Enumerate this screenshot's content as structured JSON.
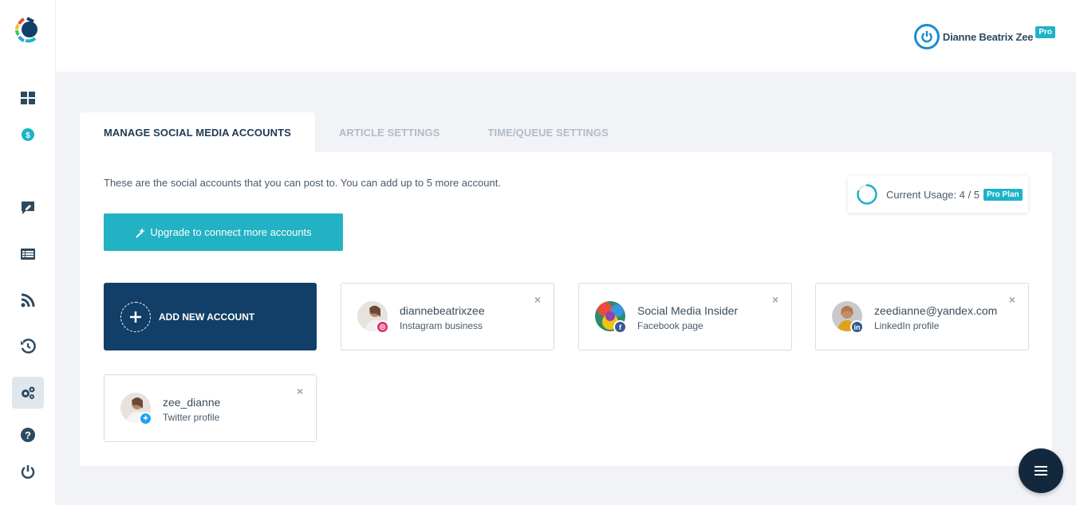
{
  "user": {
    "name": "Dianne Beatrix Zee",
    "badge": "Pro"
  },
  "tabs": [
    {
      "label": "MANAGE SOCIAL MEDIA ACCOUNTS",
      "active": true
    },
    {
      "label": "ARTICLE SETTINGS",
      "active": false
    },
    {
      "label": "TIME/QUEUE SETTINGS",
      "active": false
    }
  ],
  "panel": {
    "intro": "These are the social accounts that you can post to. You can add up to 5 more account.",
    "usage_label": "Current Usage: 4 / 5",
    "usage_used": 4,
    "usage_total": 5,
    "plan_badge": "Pro Plan",
    "upgrade_label": "Upgrade to connect more accounts",
    "add_label": "ADD NEW ACCOUNT"
  },
  "accounts": [
    {
      "name": "diannebeatrixzee",
      "type": "Instagram business",
      "network_icon": "instagram-icon",
      "color": "#e1306c"
    },
    {
      "name": "Social Media Insider",
      "type": "Facebook page",
      "network_icon": "facebook-icon",
      "color": "#3b5998"
    },
    {
      "name": "zeedianne@yandex.com",
      "type": "LinkedIn profile",
      "network_icon": "linkedin-icon",
      "color": "#2d5b8d"
    },
    {
      "name": "zee_dianne",
      "type": "Twitter profile",
      "network_icon": "twitter-icon",
      "color": "#1da1f2"
    }
  ],
  "icons": {
    "close": "×",
    "menu": "menu-icon"
  },
  "colors": {
    "accent": "#23b2c3",
    "navy": "#123f68",
    "fab": "#14283d"
  }
}
